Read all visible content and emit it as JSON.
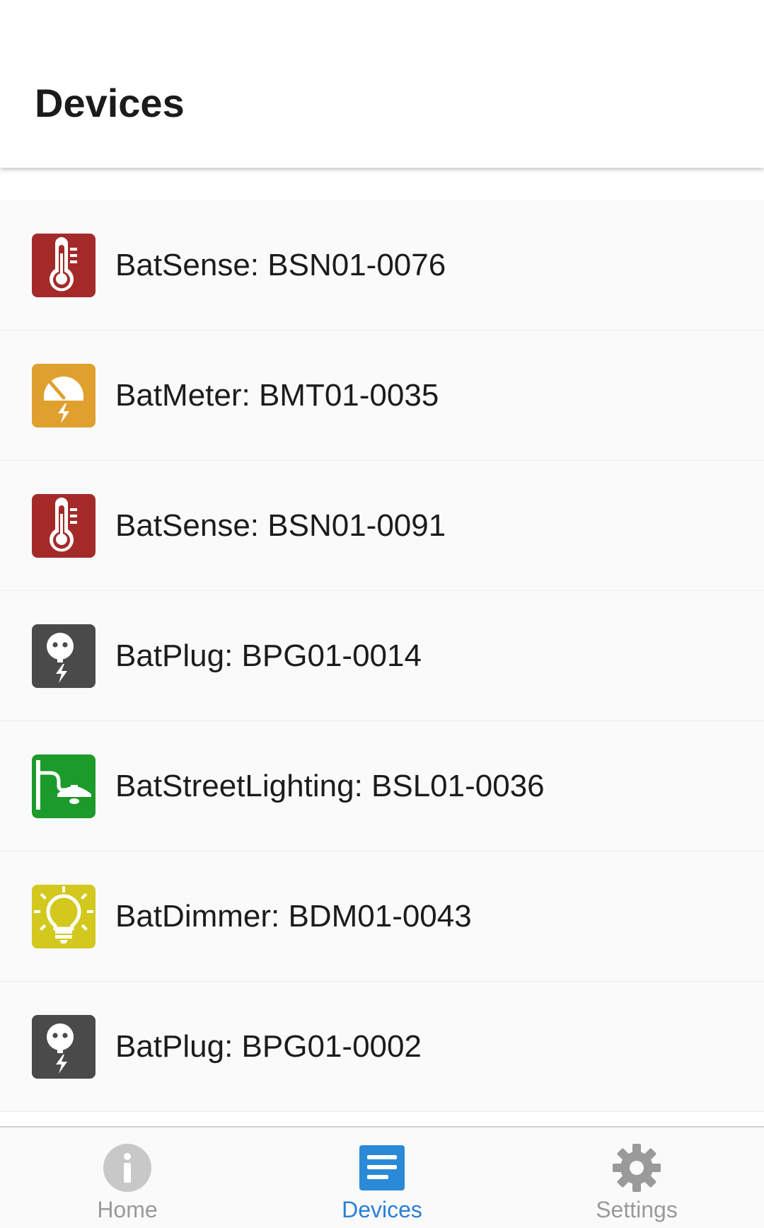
{
  "header": {
    "title": "Devices"
  },
  "devices": [
    {
      "label": "BatSense: BSN01-0076",
      "icon": "thermometer-icon",
      "color": "#a42a2a"
    },
    {
      "label": "BatMeter: BMT01-0035",
      "icon": "meter-gauge-icon",
      "color": "#e0a02e"
    },
    {
      "label": "BatSense: BSN01-0091",
      "icon": "thermometer-icon",
      "color": "#a42a2a"
    },
    {
      "label": "BatPlug: BPG01-0014",
      "icon": "plug-socket-icon",
      "color": "#4a4a4a"
    },
    {
      "label": "BatStreetLighting: BSL01-0036",
      "icon": "street-lamp-icon",
      "color": "#1c9a2a"
    },
    {
      "label": "BatDimmer: BDM01-0043",
      "icon": "light-bulb-icon",
      "color": "#d2c81e"
    },
    {
      "label": "BatPlug: BPG01-0002",
      "icon": "plug-socket-icon",
      "color": "#4a4a4a"
    }
  ],
  "tabbar": {
    "tabs": [
      {
        "label": "Home",
        "icon": "info-icon",
        "active": false
      },
      {
        "label": "Devices",
        "icon": "list-icon",
        "active": true
      },
      {
        "label": "Settings",
        "icon": "gear-icon",
        "active": false
      }
    ],
    "active_color": "#2a7fd4",
    "inactive_color": "#9a9a9a"
  }
}
